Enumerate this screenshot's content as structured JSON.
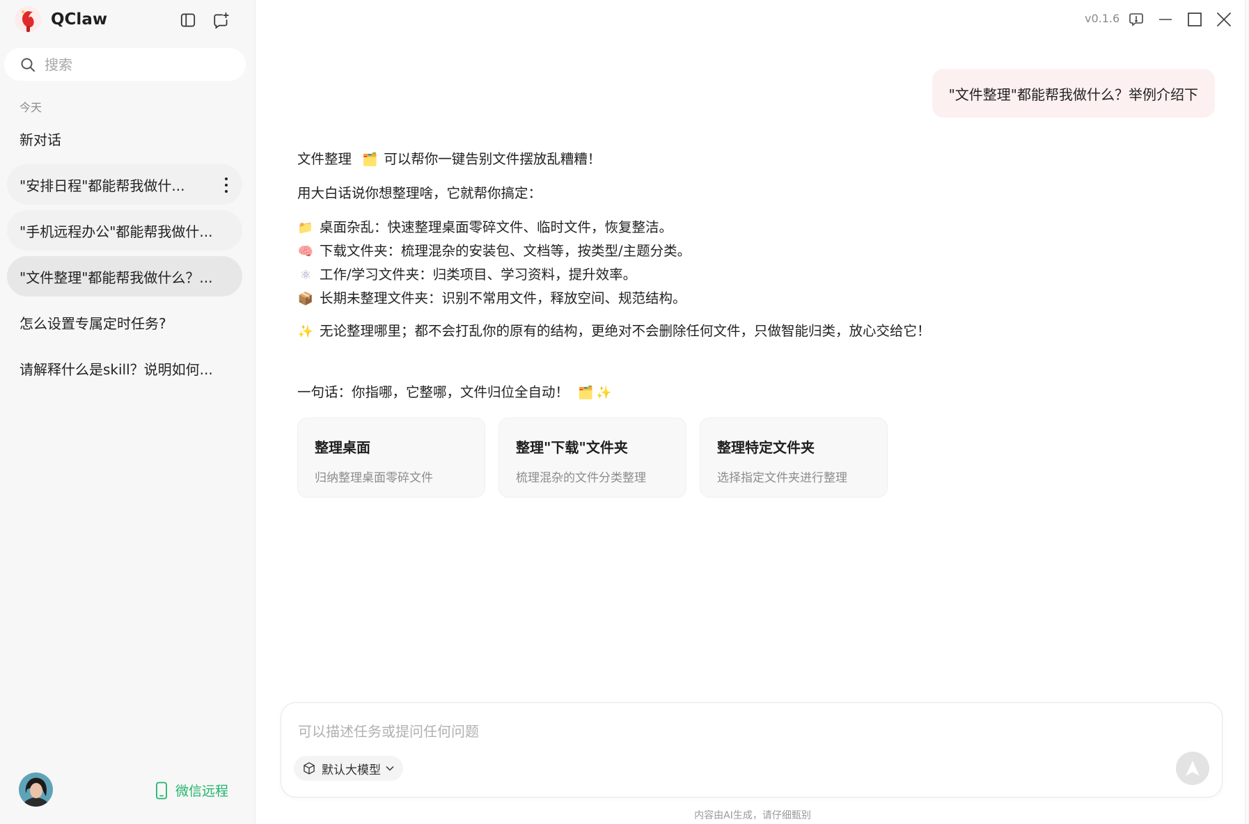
{
  "app": {
    "name": "QClaw",
    "version": "v0.1.6"
  },
  "sidebar": {
    "search_placeholder": "搜索",
    "section_label": "今天",
    "conversations": [
      {
        "label": "新对话"
      },
      {
        "label": "\"安排日程\"都能帮我做什..."
      },
      {
        "label": "\"手机远程办公\"都能帮我做什..."
      },
      {
        "label": "\"文件整理\"都能帮我做什么？..."
      },
      {
        "label": "怎么设置专属定时任务?"
      },
      {
        "label": "请解释什么是skill？说明如何..."
      }
    ],
    "wechat_remote": "微信远程"
  },
  "chat": {
    "user_message": "\"文件整理\"都能帮我做什么？举例介绍下",
    "answer": {
      "line1_a": "文件整理",
      "line1_b": "可以帮你一键告别文件摆放乱糟糟！",
      "line2": "用大白话说你想整理啥，它就帮你搞定：",
      "items": [
        {
          "icon": "📁",
          "text": "桌面杂乱：快速整理桌面零碎文件、临时文件，恢复整洁。"
        },
        {
          "icon": "🧠",
          "text": "下载文件夹：梳理混杂的安装包、文档等，按类型/主题分类。"
        },
        {
          "icon": "⚛",
          "text": "工作/学习文件夹：归类项目、学习资料，提升效率。"
        },
        {
          "icon": "📦",
          "text": "长期未整理文件夹：识别不常用文件，释放空间、规范结构。"
        }
      ],
      "note": "无论整理哪里；都不会打乱你的原有的结构，更绝对不会删除任何文件，只做智能归类，放心交给它！",
      "summary": "一句话：你指哪，它整哪，文件归位全自动！"
    },
    "cards": [
      {
        "title": "整理桌面",
        "desc": "归纳整理桌面零碎文件"
      },
      {
        "title": "整理\"下载\"文件夹",
        "desc": "梳理混杂的文件分类整理"
      },
      {
        "title": "整理特定文件夹",
        "desc": "选择指定文件夹进行整理"
      }
    ]
  },
  "composer": {
    "placeholder": "可以描述任务或提问任何问题",
    "model_label": "默认大模型"
  },
  "footer": {
    "disclaimer": "内容由AI生成，请仔细甄别"
  }
}
